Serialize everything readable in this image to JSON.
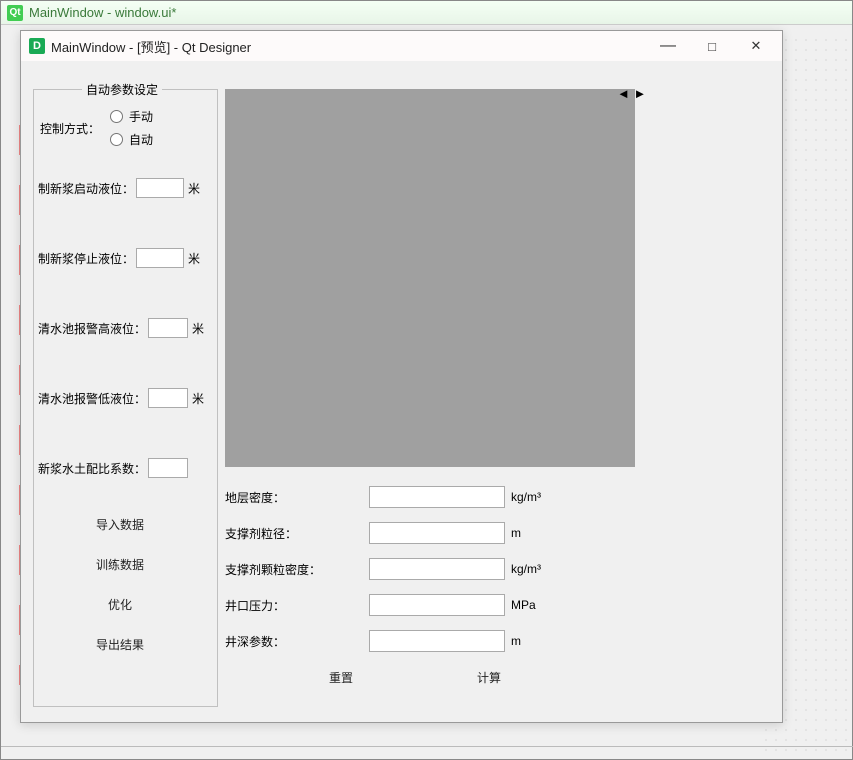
{
  "outer": {
    "title": "MainWindow - window.ui*",
    "qt_icon_text": "Qt"
  },
  "preview": {
    "title": "MainWindow - [预览] - Qt Designer",
    "d_icon_text": "D",
    "minimize": "—",
    "maximize": "□",
    "close": "✕"
  },
  "groupbox": {
    "title": "自动参数设定",
    "control_mode_label": "控制方式：",
    "radio_manual": "手动",
    "radio_auto": "自动",
    "params": {
      "start_level": {
        "label": "制新浆启动液位：",
        "value": "",
        "unit": "米"
      },
      "stop_level": {
        "label": "制新浆停止液位：",
        "value": "",
        "unit": "米"
      },
      "alarm_high": {
        "label": "清水池报警高液位：",
        "value": "",
        "unit": "米"
      },
      "alarm_low": {
        "label": "清水池报警低液位：",
        "value": "",
        "unit": "米"
      },
      "ratio": {
        "label": "新浆水土配比系数：",
        "value": "",
        "unit": ""
      }
    },
    "buttons": {
      "import": "导入数据",
      "train": "训练数据",
      "optimize": "优化",
      "export": "导出结果"
    }
  },
  "resize_arrows": "◄ ►",
  "form": {
    "rows": [
      {
        "label": "地层密度：",
        "value": "",
        "unit": "kg/m³"
      },
      {
        "label": "支撑剂粒径：",
        "value": "",
        "unit": "m"
      },
      {
        "label": "支撑剂颗粒密度：",
        "value": "",
        "unit": "kg/m³"
      },
      {
        "label": "井口压力：",
        "value": "",
        "unit": "MPa"
      },
      {
        "label": "井深参数：",
        "value": "",
        "unit": "m"
      }
    ],
    "reset_btn": "重置",
    "calc_btn": "计算"
  }
}
